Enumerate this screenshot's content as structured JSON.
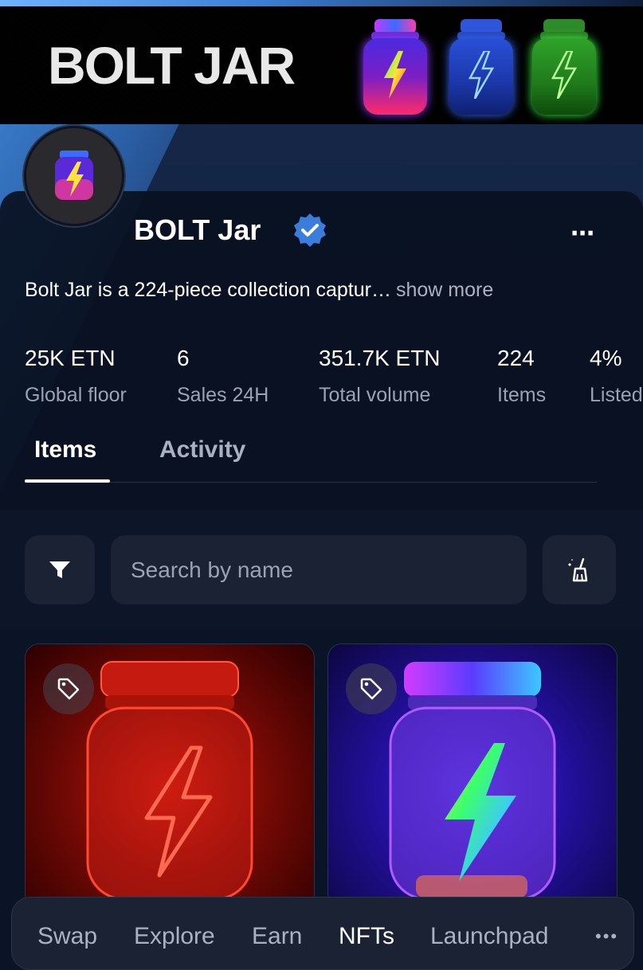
{
  "banner": {
    "title": "BOLT JAR"
  },
  "collection": {
    "name": "BOLT Jar",
    "description": "Bolt Jar is a 224-piece collection captur…",
    "show_more": "show more",
    "more_icon": "⋯"
  },
  "stats": [
    {
      "value": "25K ETN",
      "label": "Global floor"
    },
    {
      "value": "6",
      "label": "Sales 24H"
    },
    {
      "value": "351.7K ETN",
      "label": "Total volume"
    },
    {
      "value": "224",
      "label": "Items"
    },
    {
      "value": "4%",
      "label": "Listed"
    }
  ],
  "tabs": [
    {
      "label": "Items",
      "active": true
    },
    {
      "label": "Activity",
      "active": false
    }
  ],
  "search": {
    "placeholder": "Search by name"
  },
  "icons": {
    "filter": "filter-icon",
    "clean": "broom-sparkle-icon",
    "tag": "tag-icon",
    "verified": "verified-badge-icon"
  },
  "nav": {
    "items": [
      "Swap",
      "Explore",
      "Earn",
      "NFTs",
      "Launchpad"
    ],
    "active": "NFTs",
    "more": "•••"
  },
  "colors": {
    "accent_blue": "#3b7ddd",
    "card_bg": "#1a2233",
    "muted_text": "#9aa3b4"
  }
}
